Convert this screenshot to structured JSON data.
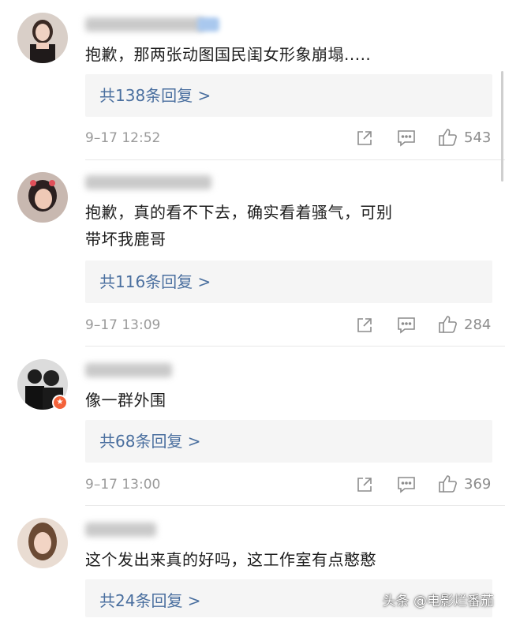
{
  "comments": [
    {
      "text": "抱歉，那两张动图国民闺女形象崩塌.....",
      "replies": "共138条回复 >",
      "time": "9–17 12:52",
      "likes": "543"
    },
    {
      "text": "抱歉，真的看不下去，确实看着骚气，可别带坏我鹿哥",
      "replies": "共116条回复 >",
      "time": "9–17 13:09",
      "likes": "284"
    },
    {
      "text": "像一群外围",
      "replies": "共68条回复 >",
      "time": "9–17 13:00",
      "likes": "369"
    },
    {
      "text": "这个发出来真的好吗，这工作室有点憨憨",
      "replies": "共24条回复 >"
    }
  ],
  "watermark": "头条 @电影烂番茄",
  "icons": {
    "share": "share-icon",
    "comment": "comment-icon",
    "like": "thumbs-up-icon"
  },
  "colors": {
    "reply_link": "#4a6f9f",
    "meta_gray": "#9a9a9a",
    "reply_bg": "#f5f5f5"
  }
}
